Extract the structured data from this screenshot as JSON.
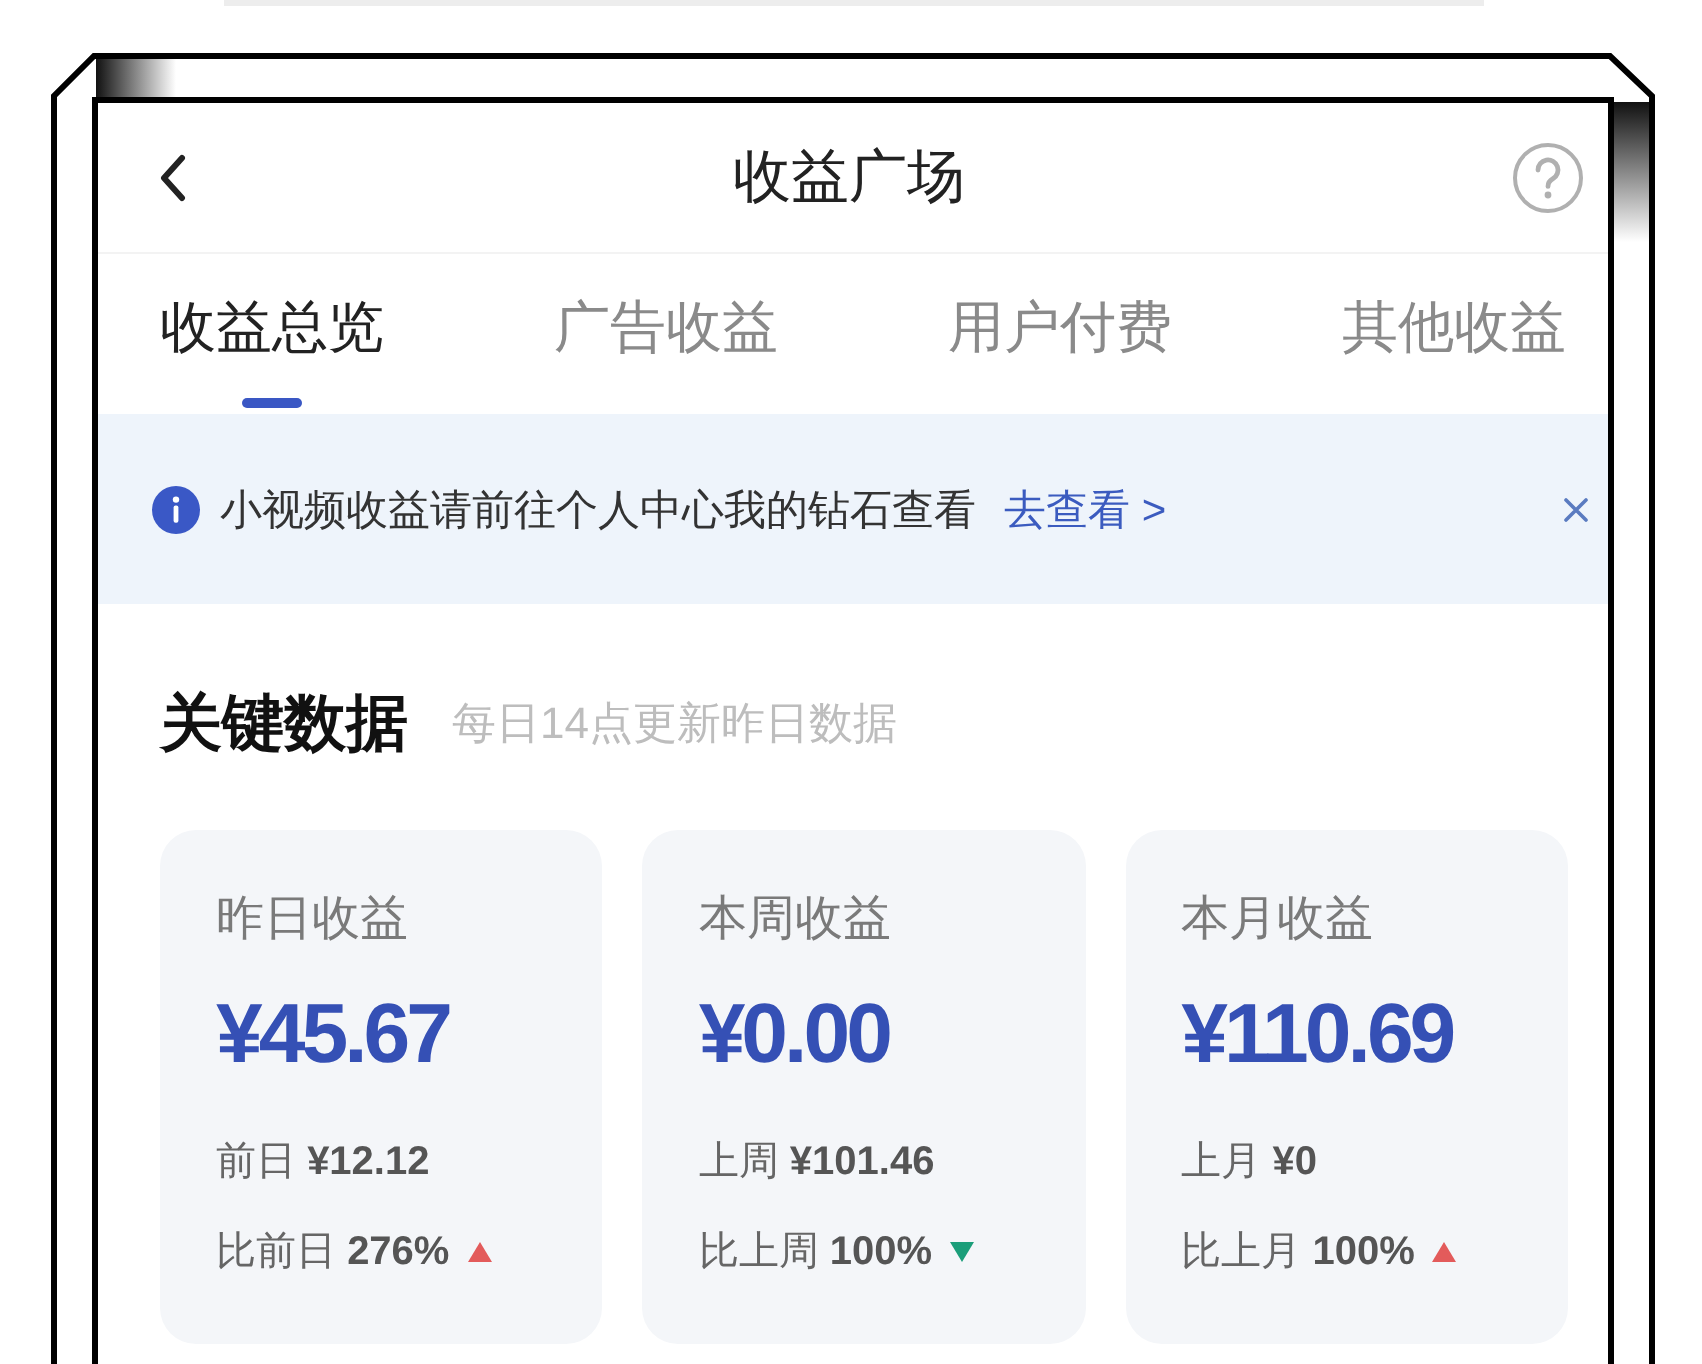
{
  "header": {
    "title": "收益广场"
  },
  "tabs": [
    {
      "label": "收益总览",
      "selected": true
    },
    {
      "label": "广告收益",
      "selected": false
    },
    {
      "label": "用户付费",
      "selected": false
    },
    {
      "label": "其他收益",
      "selected": false
    }
  ],
  "notice": {
    "text": "小视频收益请前往个人中心我的钻石查看",
    "link": "去查看 >"
  },
  "key_data": {
    "title": "关键数据",
    "subtitle": "每日14点更新昨日数据",
    "cards": [
      {
        "label": "昨日收益",
        "amount": "¥45.67",
        "previous": "前日 **¥12.12**",
        "compare": "比前日 **276%**",
        "rising": true
      },
      {
        "label": "本周收益",
        "amount": "¥0.00",
        "previous": "上周 **¥101.46**",
        "compare": "比上周 **100%**",
        "rising": false
      },
      {
        "label": "本月收益",
        "amount": "¥110.69",
        "previous": "上月 **¥0**",
        "compare": "比上月 **100%**",
        "rising": true
      }
    ]
  }
}
